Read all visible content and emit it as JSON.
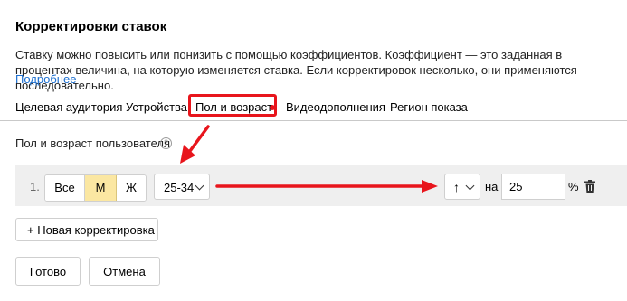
{
  "header": {
    "title": "Корректировки ставок",
    "description": "Ставку можно повысить или понизить с помощью коэффициентов. Коэффициент — это заданная в процентах величина, на которую изменяется ставка. Если корректировок несколько, они применяются последовательно.",
    "more_link": "Подробнее"
  },
  "tabs": [
    {
      "label": "Целевая аудитория"
    },
    {
      "label": "Устройства"
    },
    {
      "label": "Пол и возраст",
      "active": true
    },
    {
      "label": "Видеодополнения"
    },
    {
      "label": "Регион показа"
    }
  ],
  "section": {
    "label": "Пол и возраст пользователя",
    "help_icon": "question-circle-icon"
  },
  "adjustment": {
    "number": "1.",
    "gender_options": [
      "Все",
      "М",
      "Ж"
    ],
    "gender_selected": "М",
    "age_value": "25-34",
    "direction_symbol": "↑",
    "on_label": "на",
    "percent_value": "25",
    "percent_sign": "%",
    "delete_icon": "trash-icon"
  },
  "actions": {
    "add_label": "+ Новая корректировка",
    "done_label": "Готово",
    "cancel_label": "Отмена"
  },
  "colors": {
    "accent_red": "#e8151c",
    "link_blue": "#1c6fd0",
    "selected_yellow": "#fbe7a2",
    "row_bg": "#efefef"
  }
}
